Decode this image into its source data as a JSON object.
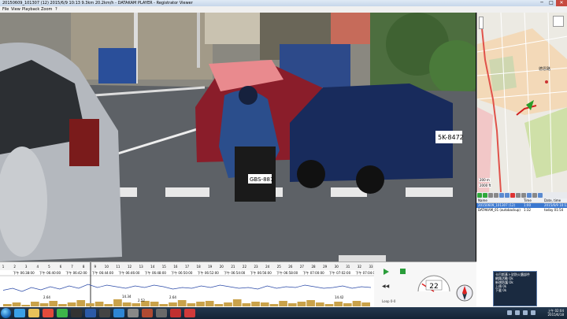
{
  "window": {
    "title": "20150609_101307 (12)     2015/6/9 10:13    9.3km    20.2km/h  -  DATAKAM PLAYER  -  Registrator Viewer",
    "min": "─",
    "max": "□",
    "close": "✕"
  },
  "menu": [
    "File",
    "View",
    "Playback",
    "Zoom",
    "?"
  ],
  "video": {
    "plate_scooter": "GBS-881",
    "plate_car": "5K-8472"
  },
  "map": {
    "label_place": "德恩路",
    "scale_top": "200 m",
    "scale_bottom": "2000 ft"
  },
  "clip_list": {
    "headers": [
      "Name",
      "Time",
      "Date, time"
    ],
    "rows": [
      {
        "name": "20150609_101307 (12)",
        "time": "1:00",
        "date": "2015/6/9 10:12",
        "selected": true
      },
      {
        "name": "DATAKAM_01 (autobackup)",
        "time": "1:32",
        "date": "today 01:54",
        "selected": false
      }
    ]
  },
  "timeline": {
    "ticks": [
      "1",
      "2",
      "3",
      "4",
      "5",
      "6",
      "7",
      "8",
      "9",
      "10",
      "11",
      "12",
      "13",
      "14",
      "15",
      "16",
      "17",
      "18",
      "19",
      "20",
      "21",
      "22",
      "23",
      "24",
      "25",
      "26",
      "27",
      "28",
      "29",
      "30",
      "31",
      "32",
      "33"
    ],
    "times": [
      "下午 06:38:00",
      "下午 06:40:00",
      "下午 06:42:00",
      "下午 06:44:00",
      "下午 06:46:00",
      "下午 06:48:00",
      "下午 06:50:00",
      "下午 06:52:00",
      "下午 06:54:00",
      "下午 06:56:00",
      "下午 06:58:00",
      "下午 07:00:00",
      "下午 07:02:00",
      "下午 07:04:00"
    ],
    "labels": [
      "2.64",
      "14.34",
      "2.52",
      "2.64",
      "14.42"
    ],
    "speed_line": [
      35,
      30,
      38,
      28,
      34,
      26,
      32,
      24,
      30,
      20,
      28,
      22,
      26,
      30,
      24,
      28,
      22,
      26,
      32,
      28,
      30,
      24,
      28,
      22,
      26,
      30,
      28,
      32,
      24,
      30,
      26,
      28,
      22,
      26,
      30,
      28,
      24,
      30,
      26,
      28
    ],
    "g_bars": [
      3,
      5,
      2,
      6,
      4,
      7,
      3,
      5,
      8,
      4,
      6,
      3,
      9,
      5,
      4,
      7,
      6,
      3,
      5,
      8,
      4,
      6,
      7,
      3,
      5,
      9,
      4,
      6,
      5,
      3,
      7,
      4,
      6,
      8,
      5,
      3,
      6,
      4,
      7,
      5
    ]
  },
  "controls": {
    "prev": "◀◀",
    "loop": "Loop 0-0",
    "speed": "22",
    "speed_pct": 0.18
  },
  "popup": {
    "lines": [
      "卡巴斯基卜對防火牆部件",
      "網路活動      Ok",
      "",
      "新增防護      Ok",
      "",
      "上傳            0k",
      "下載            0k"
    ]
  },
  "tray": {
    "time": "上午 02:04",
    "date": "2015/6/18"
  },
  "taskbar_icons": [
    {
      "name": "ie-icon",
      "color": "#3aa0e8"
    },
    {
      "name": "folder-icon",
      "color": "#e8c15a"
    },
    {
      "name": "chrome-icon",
      "color": "#e14b3b"
    },
    {
      "name": "line-icon",
      "color": "#3db54a"
    },
    {
      "name": "media-icon",
      "color": "#333"
    },
    {
      "name": "word-icon",
      "color": "#2b5aa8"
    },
    {
      "name": "video-icon",
      "color": "#444"
    },
    {
      "name": "ie2-icon",
      "color": "#2e86d6"
    },
    {
      "name": "app-icon",
      "color": "#888"
    },
    {
      "name": "app2-icon",
      "color": "#b04a32"
    },
    {
      "name": "app3-icon",
      "color": "#6a6a6a"
    },
    {
      "name": "app4-icon",
      "color": "#c03030"
    },
    {
      "name": "app5-icon",
      "color": "#d03a3a"
    }
  ]
}
